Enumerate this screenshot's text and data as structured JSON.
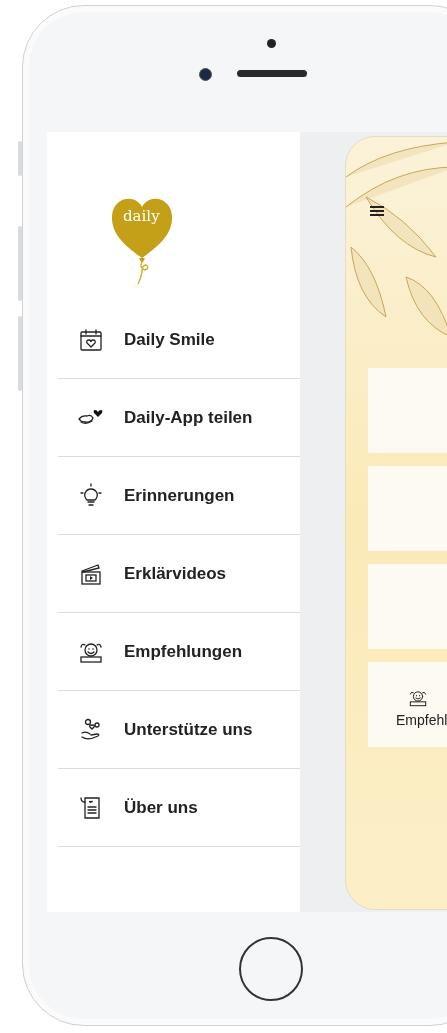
{
  "drawer": {
    "logo": {
      "text": "daily"
    },
    "items": [
      {
        "kind": "calendar",
        "label": "Daily Smile"
      },
      {
        "kind": "share",
        "label": "Daily-App teilen"
      },
      {
        "kind": "bulb",
        "label": "Erinnerungen"
      },
      {
        "kind": "video",
        "label": "Erklärvideos"
      },
      {
        "kind": "medal",
        "label": "Empfehlungen"
      },
      {
        "kind": "hand",
        "label": "Unterstütze uns"
      },
      {
        "kind": "scroll",
        "label": "Über uns"
      }
    ]
  },
  "content": {
    "panels": [
      {
        "kind": "blank"
      },
      {
        "kind": "blank"
      },
      {
        "kind": "blank"
      },
      {
        "kind": "medal",
        "label": "Empfehl"
      }
    ]
  }
}
